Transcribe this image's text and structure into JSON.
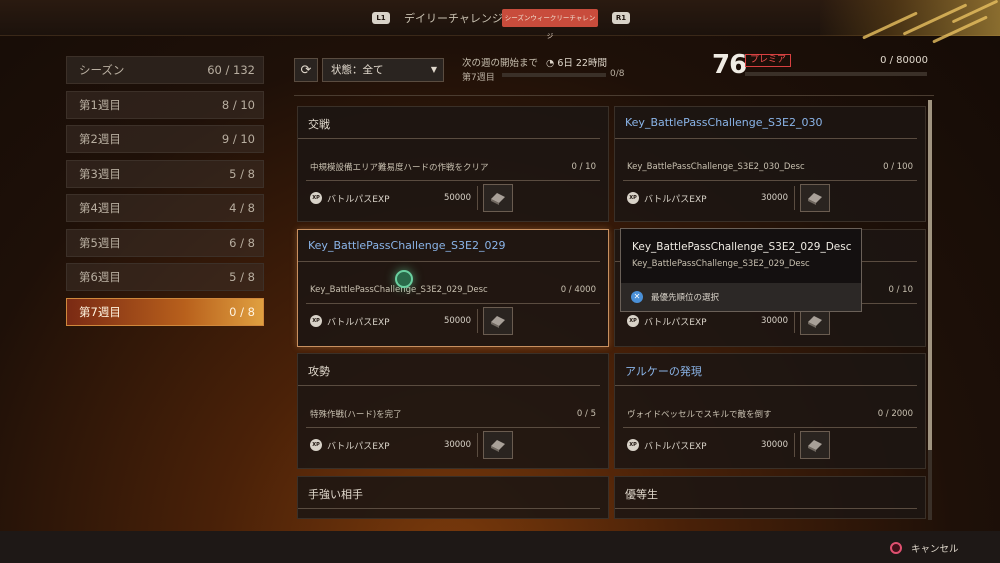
{
  "header": {
    "l1": "L1",
    "r1": "R1",
    "tabs": [
      "デイリーチャレンジ",
      "シーズンウィークリーチャレンジ"
    ]
  },
  "sidebar": [
    {
      "label": "シーズン",
      "count": "60 / 132",
      "kind": "season"
    },
    {
      "label": "第1週目",
      "count": "8 / 10"
    },
    {
      "label": "第2週目",
      "count": "9 / 10"
    },
    {
      "label": "第3週目",
      "count": "5 / 8"
    },
    {
      "label": "第4週目",
      "count": "4 / 8"
    },
    {
      "label": "第5週目",
      "count": "6 / 8"
    },
    {
      "label": "第6週目",
      "count": "5 / 8"
    },
    {
      "label": "第7週目",
      "count": "0 / 8",
      "active": true
    }
  ],
  "filter": {
    "label": "状態：全て"
  },
  "week": {
    "next_label": "次の週の開始まで",
    "timer": "6日 22時間",
    "current": "第7週目",
    "progress": "0/8",
    "progress_fraction": 0
  },
  "pass": {
    "level": "76",
    "tier": "プレミア",
    "xp": "0 / 80000",
    "xp_fraction": 0
  },
  "cards": [
    {
      "title": "交戦",
      "task": "中規模設備エリア難易度ハードの作戦をクリア",
      "progress": "0 / 10",
      "reward": "バトルパスEXP",
      "value": "50000",
      "plain": true
    },
    {
      "title": "Key_BattlePassChallenge_S3E2_030",
      "task": "Key_BattlePassChallenge_S3E2_030_Desc",
      "progress": "0 / 100",
      "reward": "バトルパスEXP",
      "value": "30000"
    },
    {
      "title": "Key_BattlePassChallenge_S3E2_029",
      "task": "Key_BattlePassChallenge_S3E2_029_Desc",
      "progress": "0 / 4000",
      "reward": "バトルパスEXP",
      "value": "50000",
      "selected": true
    },
    {
      "title": "",
      "task": "",
      "progress": "0 / 10",
      "reward": "バトルパスEXP",
      "value": "30000"
    },
    {
      "title": "攻勢",
      "task": "特殊作戦(ハード)を完了",
      "progress": "0 / 5",
      "reward": "バトルパスEXP",
      "value": "30000",
      "plain": true
    },
    {
      "title": "アルケーの発現",
      "task": "ヴォイドベッセルでスキルで敵を倒す",
      "progress": "0 / 2000",
      "reward": "バトルパスEXP",
      "value": "30000"
    },
    {
      "title": "手強い相手",
      "task": "",
      "progress": "",
      "reward": "",
      "value": "",
      "plain": true,
      "partial": true
    },
    {
      "title": "優等生",
      "task": "",
      "progress": "",
      "reward": "",
      "value": "",
      "plain": true,
      "partial": true
    }
  ],
  "tooltip": {
    "title": "Key_BattlePassChallenge_S3E2_029_Desc",
    "desc": "Key_BattlePassChallenge_S3E2_029_Desc",
    "action": "最優先順位の選択"
  },
  "footer": {
    "cancel": "キャンセル"
  },
  "icons": {
    "xp_badge": "XP"
  }
}
